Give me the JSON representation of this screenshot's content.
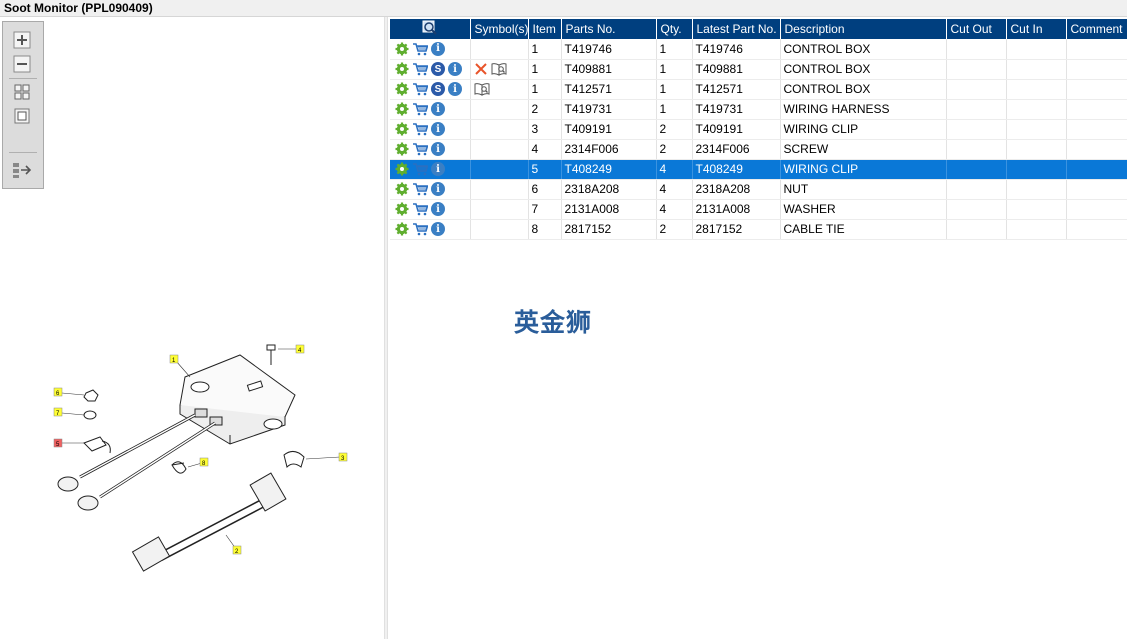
{
  "window": {
    "title": "Soot Monitor (PPL090409)"
  },
  "table": {
    "columns": [
      "",
      "Symbol(s)",
      "Item",
      "Parts No.",
      "Qty.",
      "Latest Part No.",
      "Description",
      "Cut Out",
      "Cut In",
      "Comment"
    ],
    "rows": [
      {
        "item": "1",
        "part": "T419746",
        "qty": "1",
        "latest": "T419746",
        "desc": "CONTROL BOX",
        "cut_out": "",
        "cut_in": "",
        "comment": "",
        "s_icon": false,
        "symbols": []
      },
      {
        "item": "1",
        "part": "T409881",
        "qty": "1",
        "latest": "T409881",
        "desc": "CONTROL BOX",
        "cut_out": "",
        "cut_in": "",
        "comment": "",
        "s_icon": true,
        "symbols": [
          "cross-icon",
          "book-icon"
        ]
      },
      {
        "item": "1",
        "part": "T412571",
        "qty": "1",
        "latest": "T412571",
        "desc": "CONTROL BOX",
        "cut_out": "",
        "cut_in": "",
        "comment": "",
        "s_icon": true,
        "symbols": [
          "book-icon"
        ]
      },
      {
        "item": "2",
        "part": "T419731",
        "qty": "1",
        "latest": "T419731",
        "desc": "WIRING HARNESS",
        "cut_out": "",
        "cut_in": "",
        "comment": "",
        "s_icon": false,
        "symbols": []
      },
      {
        "item": "3",
        "part": "T409191",
        "qty": "2",
        "latest": "T409191",
        "desc": "WIRING CLIP",
        "cut_out": "",
        "cut_in": "",
        "comment": "",
        "s_icon": false,
        "symbols": []
      },
      {
        "item": "4",
        "part": "2314F006",
        "qty": "2",
        "latest": "2314F006",
        "desc": "SCREW",
        "cut_out": "",
        "cut_in": "",
        "comment": "",
        "s_icon": false,
        "symbols": []
      },
      {
        "item": "5",
        "part": "T408249",
        "qty": "4",
        "latest": "T408249",
        "desc": "WIRING CLIP",
        "cut_out": "",
        "cut_in": "",
        "comment": "",
        "s_icon": false,
        "symbols": [],
        "selected": true
      },
      {
        "item": "6",
        "part": "2318A208",
        "qty": "4",
        "latest": "2318A208",
        "desc": "NUT",
        "cut_out": "",
        "cut_in": "",
        "comment": "",
        "s_icon": false,
        "symbols": []
      },
      {
        "item": "7",
        "part": "2131A008",
        "qty": "4",
        "latest": "2131A008",
        "desc": "WASHER",
        "cut_out": "",
        "cut_in": "",
        "comment": "",
        "s_icon": false,
        "symbols": []
      },
      {
        "item": "8",
        "part": "2817152",
        "qty": "2",
        "latest": "2817152",
        "desc": "CABLE TIE",
        "cut_out": "",
        "cut_in": "",
        "comment": "",
        "s_icon": false,
        "symbols": []
      }
    ]
  },
  "toolbar": {
    "icons": [
      "zoom-in-icon",
      "zoom-out-icon",
      "fit-all-icon",
      "fit-window-icon",
      "list-export-icon"
    ]
  },
  "diagram": {
    "callouts": [
      "1",
      "2",
      "3",
      "4",
      "5",
      "6",
      "7",
      "8"
    ],
    "highlighted": "5"
  },
  "watermark": "英金狮",
  "colors": {
    "header": "#003f7f",
    "selected": "#0a78d7",
    "callout": "#ffff33",
    "callout_selected": "#f06060"
  }
}
